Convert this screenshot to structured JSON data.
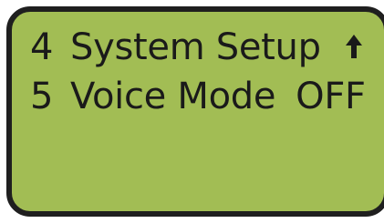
{
  "display": {
    "rows": [
      {
        "number": "4",
        "label": "System Setup",
        "value": "",
        "indicator_icon": "up-arrow-icon"
      },
      {
        "number": "5",
        "label": "Voice Mode",
        "value": "OFF"
      }
    ]
  },
  "colors": {
    "lcd_background": "#a2bd54",
    "bezel": "#1f1f1f",
    "text": "#1a1a1a"
  }
}
